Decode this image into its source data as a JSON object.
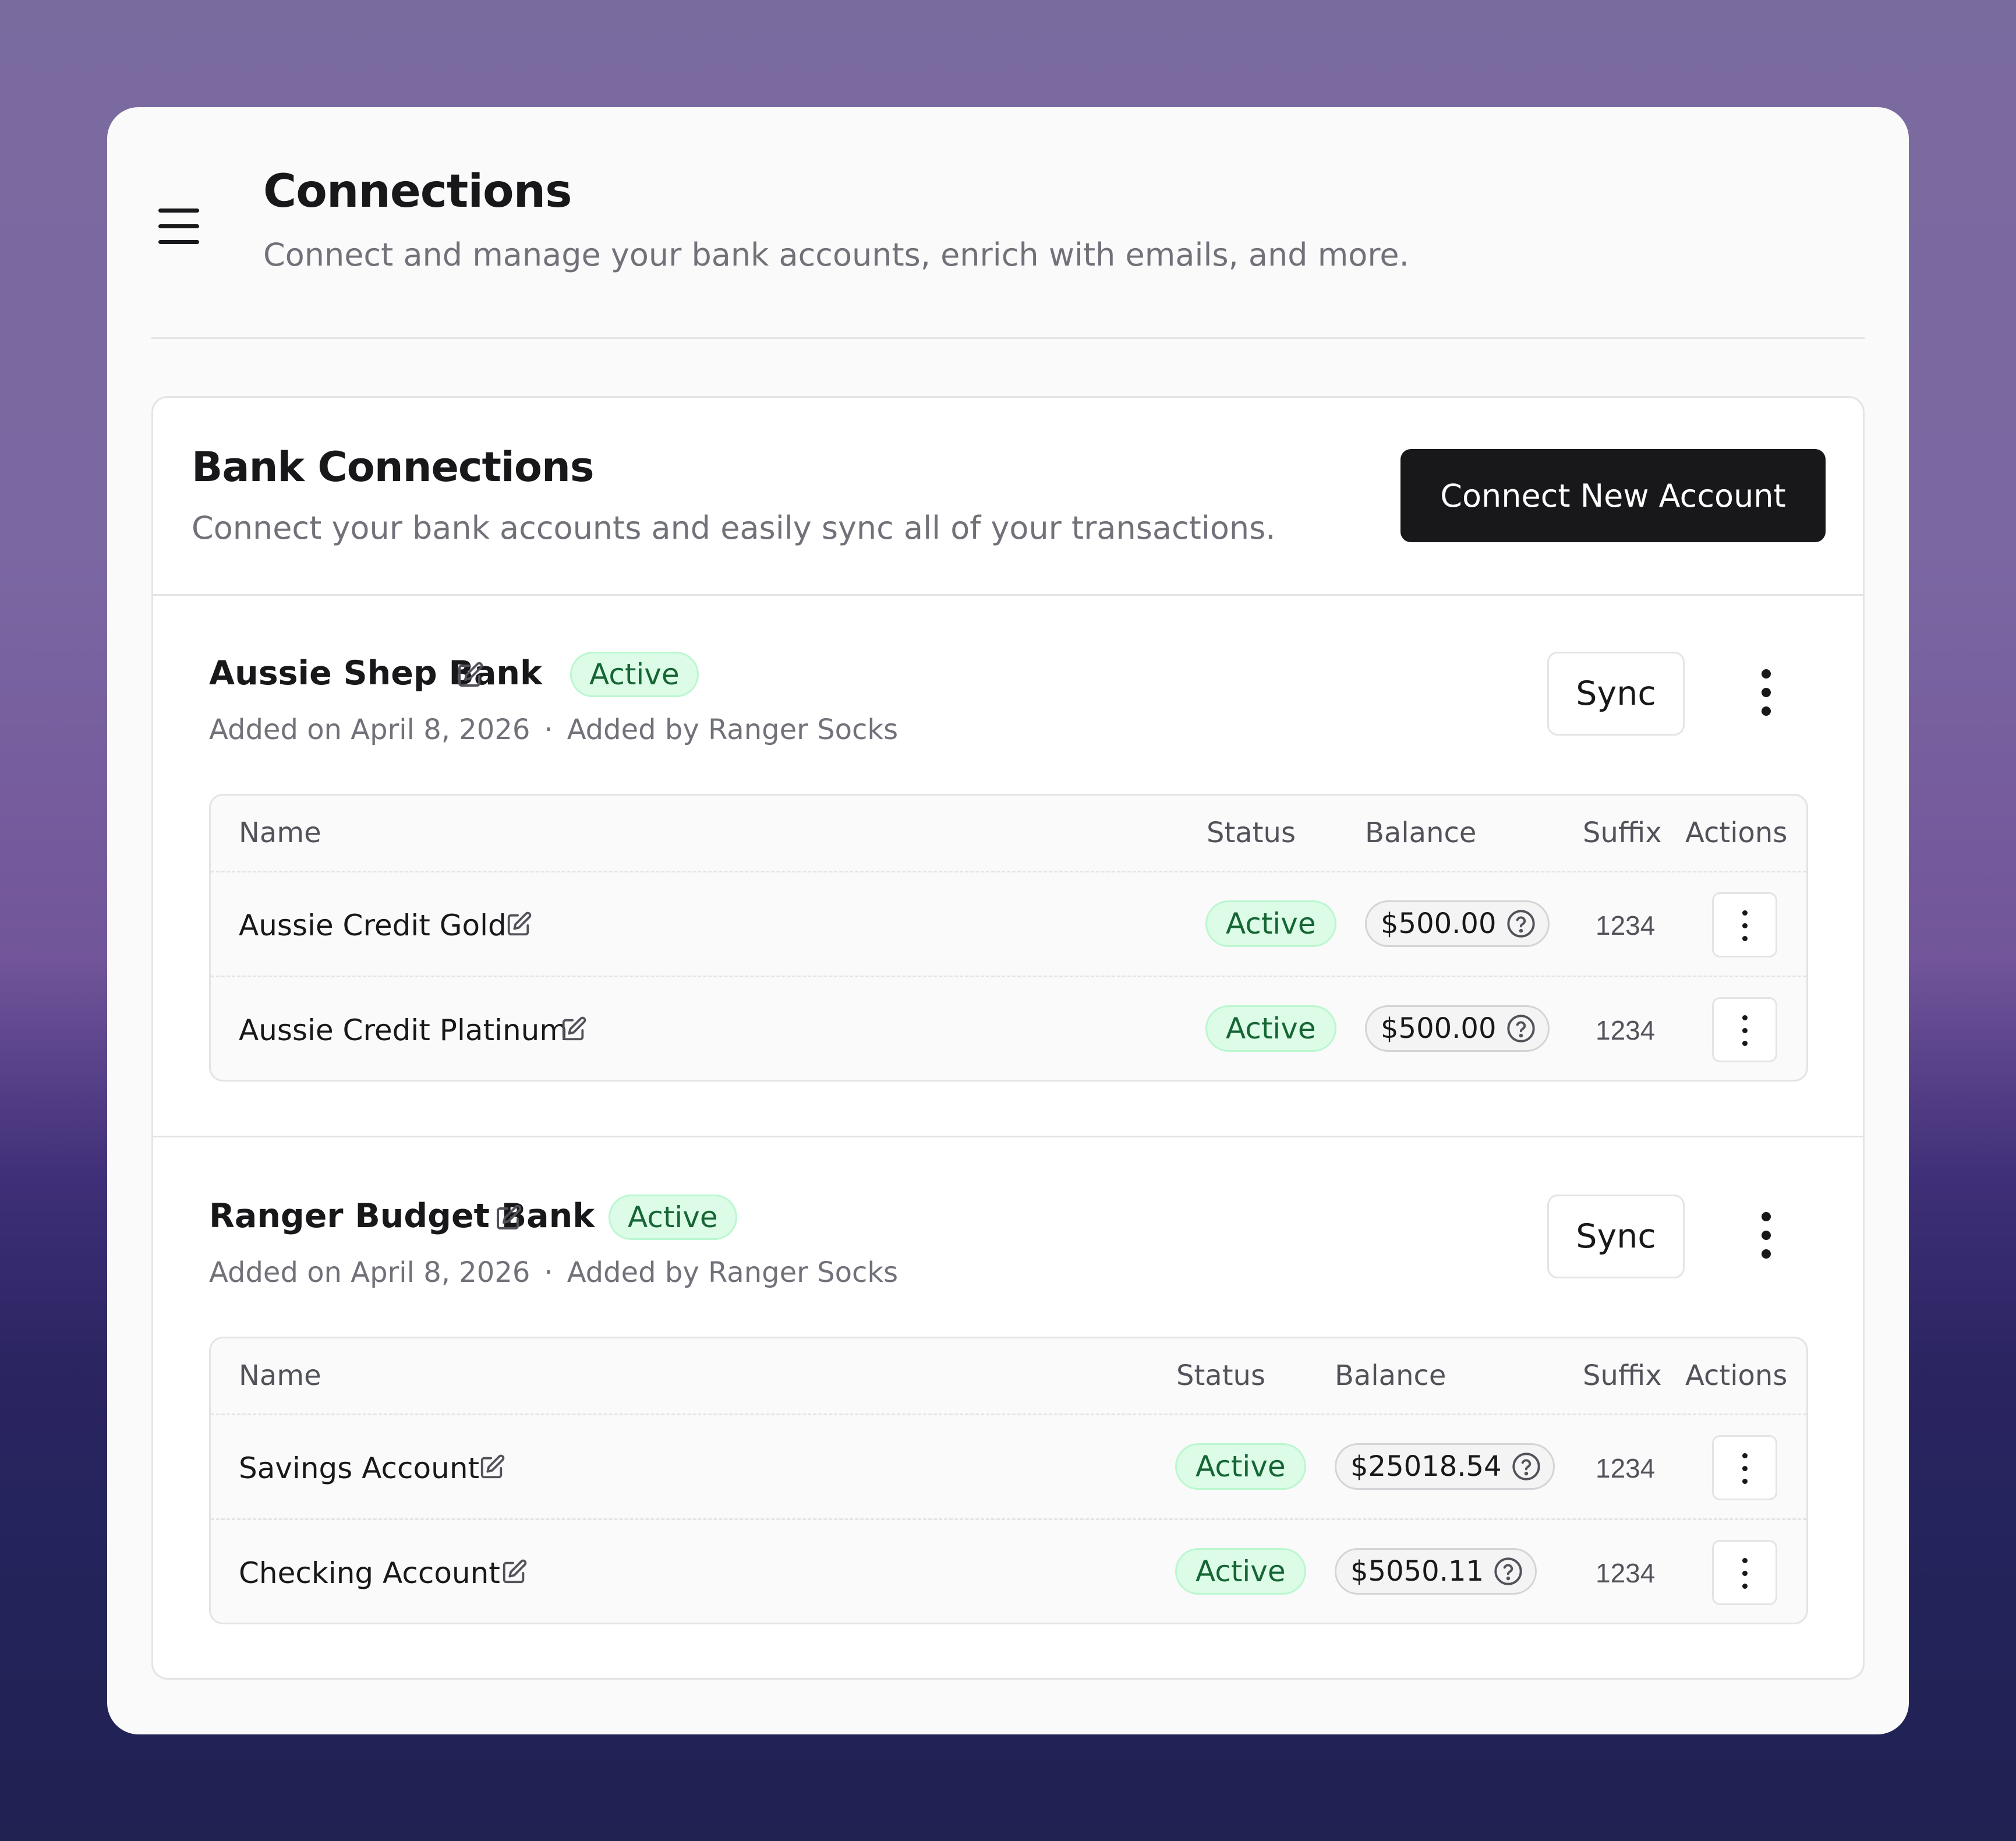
{
  "page": {
    "title": "Connections",
    "subtitle": "Connect and manage your bank accounts, enrich with emails, and more."
  },
  "section": {
    "title": "Bank Connections",
    "subtitle": "Connect your bank accounts and easily sync all of your transactions.",
    "connect_label": "Connect New Account"
  },
  "table_headers": {
    "name": "Name",
    "status": "Status",
    "balance": "Balance",
    "suffix": "Suffix",
    "actions": "Actions"
  },
  "banks": [
    {
      "name": "Aussie Shep Bank",
      "status": "Active",
      "added_on": "Added on April 8, 2026",
      "separator": "·",
      "added_by": "Added by Ranger Socks",
      "sync_label": "Sync",
      "accounts": [
        {
          "name": "Aussie Credit Gold",
          "status": "Active",
          "balance": "$500.00",
          "suffix": "1234"
        },
        {
          "name": "Aussie Credit Platinum",
          "status": "Active",
          "balance": "$500.00",
          "suffix": "1234"
        }
      ]
    },
    {
      "name": "Ranger Budget Bank",
      "status": "Active",
      "added_on": "Added on April 8, 2026",
      "separator": "·",
      "added_by": "Added by Ranger Socks",
      "sync_label": "Sync",
      "accounts": [
        {
          "name": "Savings Account",
          "status": "Active",
          "balance": "$25018.54",
          "suffix": "1234"
        },
        {
          "name": "Checking Account",
          "status": "Active",
          "balance": "$5050.11",
          "suffix": "1234"
        }
      ]
    }
  ],
  "colors": {
    "primary_button": "#18181b",
    "status_bg": "#dcfce7",
    "status_text": "#166534",
    "muted_text": "#71717a"
  },
  "icons": {
    "menu": "hamburger-menu-icon",
    "edit": "edit-icon",
    "help": "question-circle-icon",
    "more": "vertical-ellipsis-icon"
  }
}
